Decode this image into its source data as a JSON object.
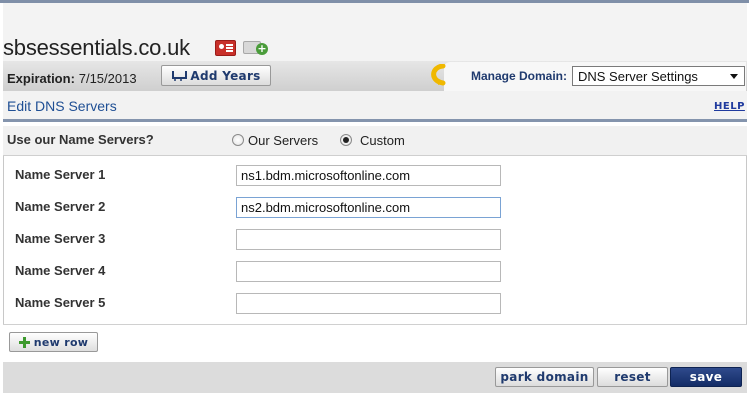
{
  "domain": {
    "name": "sbsessentials.co.uk"
  },
  "title_icons": {
    "contact": "contact-card-icon",
    "add": "add-contact-icon"
  },
  "expiration": {
    "label": "Expiration:",
    "date": "7/15/2013"
  },
  "add_years": {
    "label": "Add Years",
    "icon": "cart-icon"
  },
  "manage_domain": {
    "label": "Manage Domain:",
    "selected": "DNS Server Settings"
  },
  "section": {
    "title": "Edit DNS Servers",
    "help": "HELP"
  },
  "use_name_servers": {
    "question": "Use our Name Servers?",
    "options": [
      {
        "label": "Our Servers",
        "checked": false
      },
      {
        "label": "Custom",
        "checked": true
      }
    ]
  },
  "name_servers": [
    {
      "label": "Name Server 1",
      "value": "ns1.bdm.microsoftonline.com"
    },
    {
      "label": "Name Server 2",
      "value": "ns2.bdm.microsoftonline.com"
    },
    {
      "label": "Name Server 3",
      "value": ""
    },
    {
      "label": "Name Server 4",
      "value": ""
    },
    {
      "label": "Name Server 5",
      "value": ""
    }
  ],
  "new_row": {
    "label": "new row"
  },
  "footer": {
    "park": "park domain",
    "reset": "reset",
    "save": "save"
  },
  "colors": {
    "accent": "#1f3a6e",
    "link": "#1f4f94",
    "rule": "#8494ad",
    "save_bg": "#1f3a6e"
  }
}
